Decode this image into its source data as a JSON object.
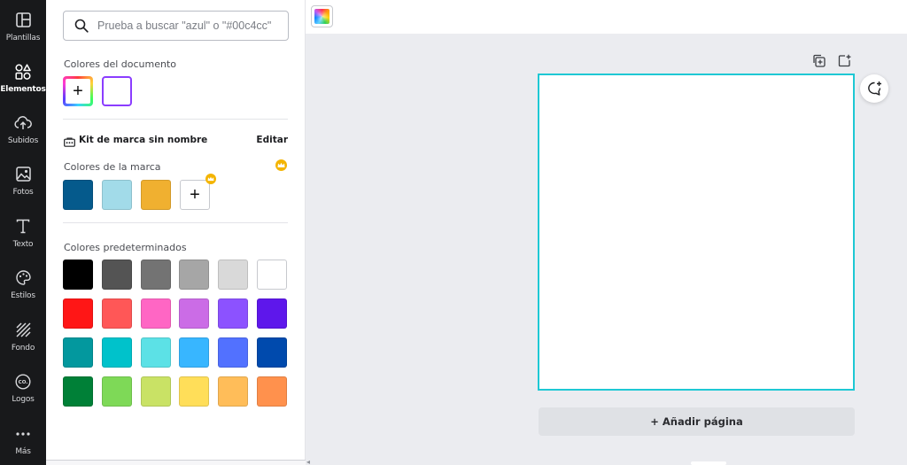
{
  "nav": {
    "items": [
      {
        "label": "Plantillas",
        "icon": "templates-icon"
      },
      {
        "label": "Elementos",
        "icon": "elements-icon"
      },
      {
        "label": "Subidos",
        "icon": "upload-cloud-icon"
      },
      {
        "label": "Fotos",
        "icon": "photos-icon"
      },
      {
        "label": "Texto",
        "icon": "text-icon"
      },
      {
        "label": "Estilos",
        "icon": "palette-icon"
      },
      {
        "label": "Fondo",
        "icon": "background-pattern-icon"
      },
      {
        "label": "Logos",
        "icon": "logo-icon"
      },
      {
        "label": "Más",
        "icon": "more-dots-icon"
      }
    ],
    "active": "Elementos"
  },
  "search": {
    "placeholder": "Prueba a buscar \"azul\" o \"#00c4cc\""
  },
  "document_colors": {
    "title": "Colores del documento",
    "colors": [
      "#ffffff"
    ],
    "selected_border": "#8b3dff"
  },
  "brand_kit": {
    "name": "Kit de marca sin nombre",
    "edit_label": "Editar",
    "colors_title": "Colores de la marca",
    "colors": [
      "#055a8c",
      "#a2dbe9",
      "#f0b030"
    ],
    "pro_badge_color": "#f4b400"
  },
  "default_colors": {
    "title": "Colores predeterminados",
    "rows": [
      [
        "#000000",
        "#545454",
        "#737373",
        "#a6a6a6",
        "#d9d9d9",
        "#ffffff"
      ],
      [
        "#ff1616",
        "#ff5757",
        "#ff66c4",
        "#cb6ce6",
        "#8c52ff",
        "#5e17eb"
      ],
      [
        "#03989e",
        "#00c2cb",
        "#5ce1e6",
        "#38b6ff",
        "#5271ff",
        "#004aad"
      ],
      [
        "#008037",
        "#7ed957",
        "#c9e265",
        "#ffde59",
        "#ffbd59",
        "#ff914d"
      ]
    ]
  },
  "canvas": {
    "border_color": "#1ec8d4",
    "add_page_label": "+ Añadir página"
  }
}
